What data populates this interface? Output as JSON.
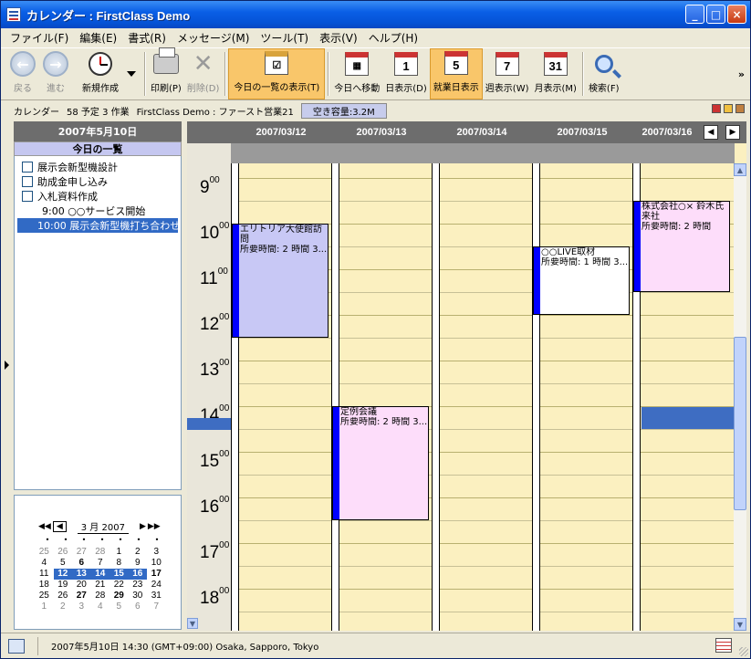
{
  "window": {
    "title": "カレンダー : FirstClass Demo",
    "controls": {
      "minimize": "_",
      "maximize": "□",
      "close": "×"
    }
  },
  "menu": [
    "ファイル(F)",
    "編集(E)",
    "書式(R)",
    "メッセージ(M)",
    "ツール(T)",
    "表示(V)",
    "ヘルプ(H)"
  ],
  "toolbar": {
    "back": "戻る",
    "forward": "進む",
    "new": "新規作成",
    "print": "印刷(P)",
    "delete": "削除(D)",
    "today_list": "今日の一覧の表示(T)",
    "go_today": "今日へ移動",
    "day_view": "日表示(D)",
    "workweek_view": "就業日表示",
    "week_view": "週表示(W)",
    "month_view": "月表示(M)",
    "search": "検索(F)",
    "cal_icons": {
      "day": "1",
      "workweek": "5",
      "week": "7",
      "month": "31"
    },
    "more": "»"
  },
  "statusline": {
    "name": "カレンダー",
    "counts": "58 予定 3 作業",
    "path": "FirstClass Demo : ファースト営業21",
    "space": "空き容量:3.2M"
  },
  "left_panel": {
    "date": "2007年5月10日",
    "today_header": "今日の一覧",
    "tasks": [
      {
        "label": "展示会新型機設計"
      },
      {
        "label": "助成金申し込み"
      },
      {
        "label": "入札資料作成"
      }
    ],
    "events": [
      {
        "label": "9:00 ○○サービス開始"
      },
      {
        "label": "10:00 展示会新型機打ち合わせ"
      }
    ]
  },
  "mini_calendar": {
    "month_label": "3 月 2007",
    "nav": {
      "prev_year": "◀◀",
      "prev_month": "◀",
      "next_month": "▶",
      "next_year": "▶▶"
    },
    "weeks": [
      [
        "25",
        "26",
        "27",
        "28",
        "1",
        "2",
        "3"
      ],
      [
        "4",
        "5",
        "6",
        "7",
        "8",
        "9",
        "10"
      ],
      [
        "11",
        "12",
        "13",
        "14",
        "15",
        "16",
        "17"
      ],
      [
        "18",
        "19",
        "20",
        "21",
        "22",
        "23",
        "24"
      ],
      [
        "25",
        "26",
        "27",
        "28",
        "29",
        "30",
        "31"
      ],
      [
        "1",
        "2",
        "3",
        "4",
        "5",
        "6",
        "7"
      ]
    ]
  },
  "calendar": {
    "days": [
      "2007/03/12",
      "2007/03/13",
      "2007/03/14",
      "2007/03/15",
      "2007/03/16"
    ],
    "hours": [
      "9",
      "10",
      "11",
      "12",
      "13",
      "14",
      "15",
      "16",
      "17",
      "18"
    ],
    "minute_suffix": "00",
    "nav": {
      "prev": "◀",
      "next": "▶"
    },
    "events": [
      {
        "title": "エリトリア大使館訪問",
        "duration": "所要時間: 2 時間 3...",
        "color": "#C8C8F5"
      },
      {
        "title": "定例会議",
        "duration": "所要時間: 2 時間 3...",
        "color": "#FDDDFA"
      },
      {
        "title": "○○LIVE取材",
        "duration": "所要時間: 1 時間 3...",
        "color": "#FFFFFF"
      },
      {
        "title": "株式会社○× 鈴木氏来社",
        "duration": "所要時間: 2 時間",
        "color": "#FDDDFA"
      }
    ]
  },
  "bottombar": {
    "datetime": "2007年5月10日 14:30 (GMT+09:00) Osaka, Sapporo, Tokyo"
  }
}
